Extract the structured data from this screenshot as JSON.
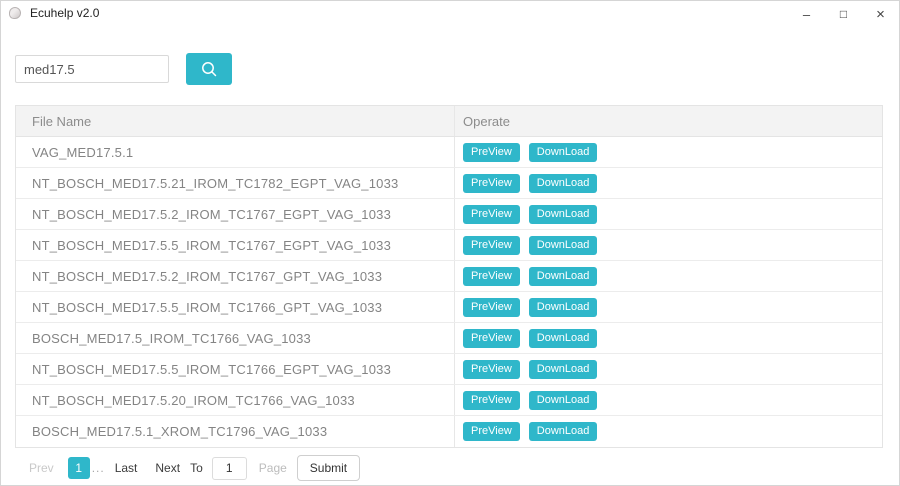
{
  "window": {
    "title": "Ecuhelp v2.0",
    "controls": {
      "minimize": "–",
      "maximize": "□",
      "close": "×"
    }
  },
  "icons": {
    "app": "app-logo",
    "search": "magnifier",
    "minimize": "minimize-dash",
    "maximize": "maximize-square",
    "close": "close-x"
  },
  "colors": {
    "accent": "#2fb7ca",
    "header_bg": "#f3f3f3",
    "table_border": "#e4e4e4",
    "text_gray": "#848484"
  },
  "search": {
    "value": "med17.5"
  },
  "table": {
    "headers": {
      "file_name": "File Name",
      "operate": "Operate"
    },
    "preview_label": "PreView",
    "download_label": "DownLoad",
    "rows": [
      "VAG_MED17.5.1",
      "NT_BOSCH_MED17.5.21_IROM_TC1782_EGPT_VAG_1033",
      "NT_BOSCH_MED17.5.2_IROM_TC1767_EGPT_VAG_1033",
      "NT_BOSCH_MED17.5.5_IROM_TC1767_EGPT_VAG_1033",
      "NT_BOSCH_MED17.5.2_IROM_TC1767_GPT_VAG_1033",
      "NT_BOSCH_MED17.5.5_IROM_TC1766_GPT_VAG_1033",
      "BOSCH_MED17.5_IROM_TC1766_VAG_1033",
      "NT_BOSCH_MED17.5.5_IROM_TC1766_EGPT_VAG_1033",
      "NT_BOSCH_MED17.5.20_IROM_TC1766_VAG_1033",
      "BOSCH_MED17.5.1_XROM_TC1796_VAG_1033"
    ]
  },
  "pagination": {
    "prev": "Prev",
    "current_page": "1",
    "ellipsis": "...",
    "last": "Last",
    "next": "Next",
    "to": "To",
    "page_input_value": "1",
    "page_label": "Page",
    "submit": "Submit"
  }
}
